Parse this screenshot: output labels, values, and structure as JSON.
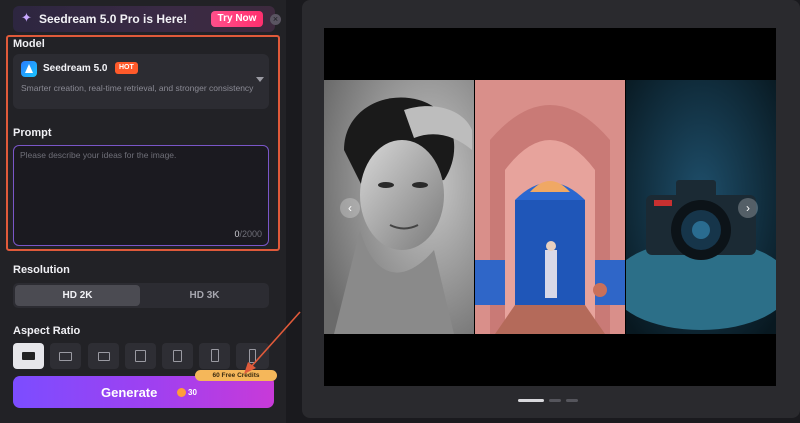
{
  "banner": {
    "title": "Seedream 5.0 Pro is Here!",
    "cta": "Try Now",
    "close": "×"
  },
  "model": {
    "section_label": "Model",
    "name": "Seedream 5.0",
    "badge": "HOT",
    "description": "Smarter creation, real-time retrieval, and stronger consistency"
  },
  "prompt": {
    "section_label": "Prompt",
    "placeholder": "Please describe your ideas for the image.",
    "value": "",
    "count_current": "0",
    "count_max": "/2000"
  },
  "resolution": {
    "section_label": "Resolution",
    "options": [
      {
        "label": "HD 2K",
        "selected": true
      },
      {
        "label": "HD 3K",
        "selected": false
      }
    ]
  },
  "aspect_ratio": {
    "section_label": "Aspect Ratio",
    "selected_index": 0
  },
  "generate": {
    "label": "Generate",
    "cost": "30",
    "credits_badge": "60 Free Credits"
  },
  "carousel": {
    "prev": "‹",
    "next": "›",
    "slides": [
      "portrait",
      "doorway",
      "camera"
    ],
    "active_dot": 0
  },
  "colors": {
    "accent": "#7c4dff",
    "highlight": "#e05a3a",
    "hot_badge": "#ff5a2a",
    "cta": "#ff2f6e"
  }
}
